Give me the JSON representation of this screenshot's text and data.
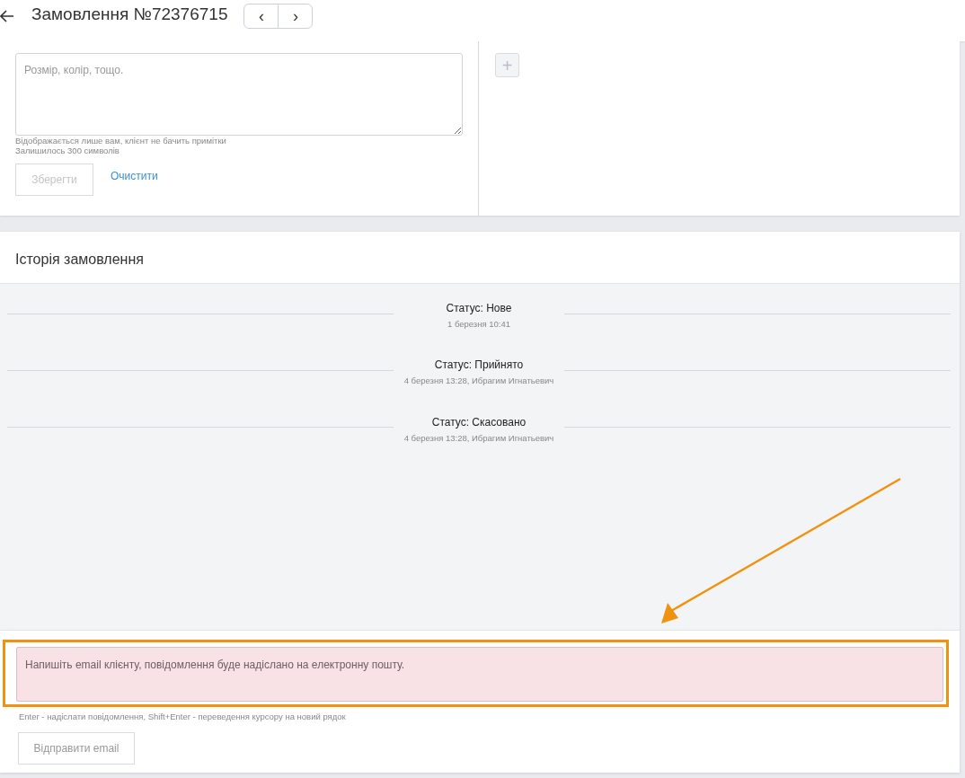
{
  "header": {
    "title": "Замовлення №72376715",
    "nav_buttons": [
      "‹",
      "›"
    ]
  },
  "note": {
    "placeholder": "Розмір, колір, тощо.",
    "hint": "Відображається лише вам, клієнт не бачить примітки",
    "counter": "Залишилось 300 символів",
    "save": {
      "label": "Зберегти",
      "disabled": true
    },
    "clear": "Очистити"
  },
  "add_button": {
    "label": "+",
    "disabled": true
  },
  "history": {
    "title": "Історія замовлення",
    "events": [
      {
        "status": "Статус: Нове",
        "meta": "1 березня 10:41"
      },
      {
        "status": "Статус: Прийнято",
        "meta": "4 березня 13:28, Ибрагим Игнатьевич"
      },
      {
        "status": "Статус: Скасовано",
        "meta": "4 березня 13:28, Ибрагим Игнатьевич"
      }
    ]
  },
  "email": {
    "placeholder": "Напишіть email клієнту, повідомлення буде надіслано на електронну пошту.",
    "highlighted": true,
    "hint": "Enter - надіслати повідомлення, Shift+Enter - переведення курсору на новий рядок",
    "send": {
      "label": "Відправити email",
      "disabled": true
    }
  }
}
